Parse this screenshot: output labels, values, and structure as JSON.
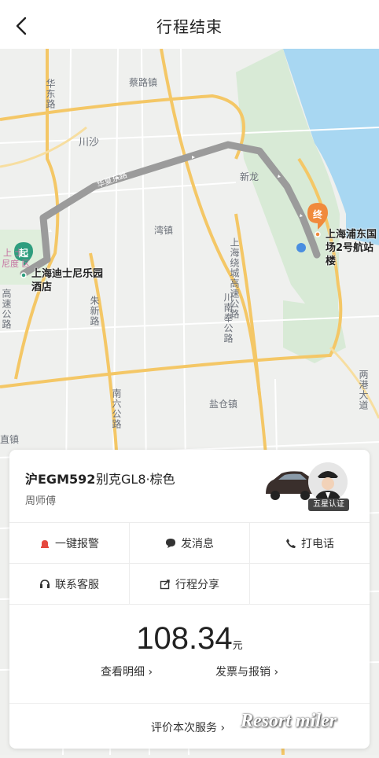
{
  "header": {
    "title": "行程结束"
  },
  "map": {
    "places": [
      "蔡路镇",
      "川沙",
      "新龙",
      "湾镇",
      "盐仓镇",
      "直镇"
    ],
    "roads": [
      "华东路",
      "迪士尼",
      "华夏东路",
      "上海绕城高速公路",
      "川南奉公路",
      "南六公路",
      "朱新路",
      "高速公路",
      "两港大道"
    ],
    "start_badge": "起",
    "end_badge": "终",
    "start_label": [
      "上海迪士尼乐园",
      "酒店"
    ],
    "end_label": [
      "上海浦东国",
      "场2号航站楼"
    ],
    "disney_area": [
      "上 士",
      "尼度 区"
    ]
  },
  "trip": {
    "plate": "沪EGM592",
    "car_model": "别克GL8·棕色",
    "driver_name": "周师傅",
    "driver_badge": "五星认证"
  },
  "actions": {
    "alarm": "一键报警",
    "message": "发消息",
    "call": "打电话",
    "service": "联系客服",
    "share": "行程分享"
  },
  "fare": {
    "amount": "108.34",
    "unit": "元",
    "detail_link": "查看明细 ›",
    "invoice_link": "发票与报销 ›"
  },
  "rating": {
    "label": "评价本次服务 ›"
  },
  "watermark": "Resort miler",
  "colors": {
    "route": "#9b9b9b",
    "start": "#2e9e7e",
    "end": "#f08a3c",
    "alarm": "#e5493f"
  }
}
